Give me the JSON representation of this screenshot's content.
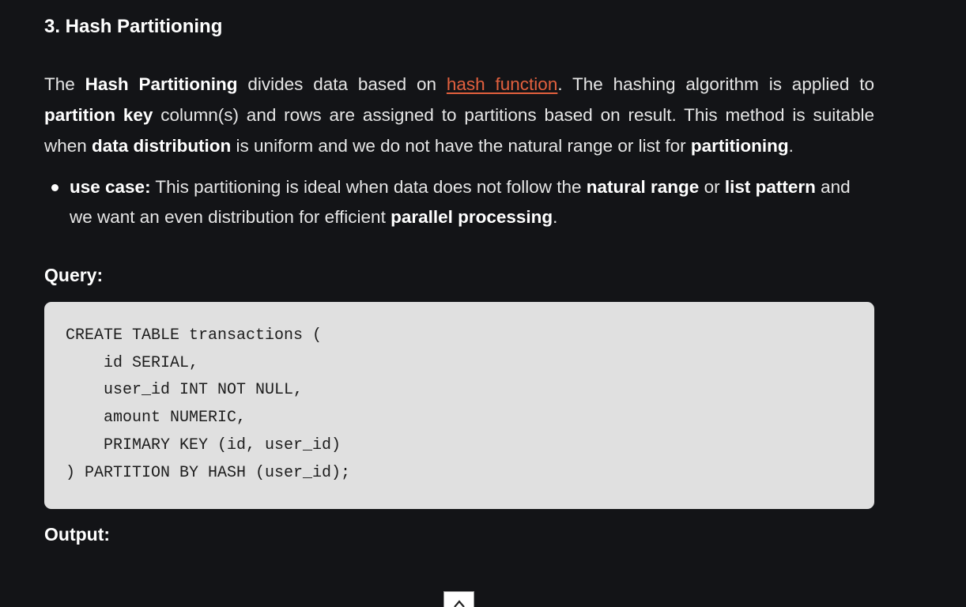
{
  "heading": "3. Hash Partitioning",
  "paragraph": {
    "t1": "The ",
    "b1": "Hash Partitioning",
    "t2": " divides data based on ",
    "link": "hash function",
    "t3": ". The hashing algorithm is applied to ",
    "b2": "partition key",
    "t4": " column(s) and rows are assigned to partitions based on result. This method is suitable when ",
    "b3": "data distribution",
    "t5": " is uniform and we do not have the natural range or list for ",
    "b4": "partitioning",
    "t6": "."
  },
  "bullet": {
    "label": "use case:",
    "t1": " This partitioning is ideal when data does not follow the ",
    "b1": "natural range",
    "t2": " or ",
    "b2": "list pattern",
    "t3": " and we want an even distribution for efficient ",
    "b3": "parallel processing",
    "t4": "."
  },
  "query_heading": "Query:",
  "code_lines": [
    "CREATE TABLE transactions (",
    "    id SERIAL,",
    "    user_id INT NOT NULL,",
    "    amount NUMERIC,",
    "    PRIMARY KEY (id, user_id)",
    ") PARTITION BY HASH (user_id);"
  ],
  "output_heading": "Output:",
  "colors": {
    "background": "#131417",
    "text": "#e6e6e6",
    "link": "#e2603e",
    "code_background": "#e0e0e0"
  },
  "icons": {
    "scroll_top": "chevron-up-icon"
  }
}
